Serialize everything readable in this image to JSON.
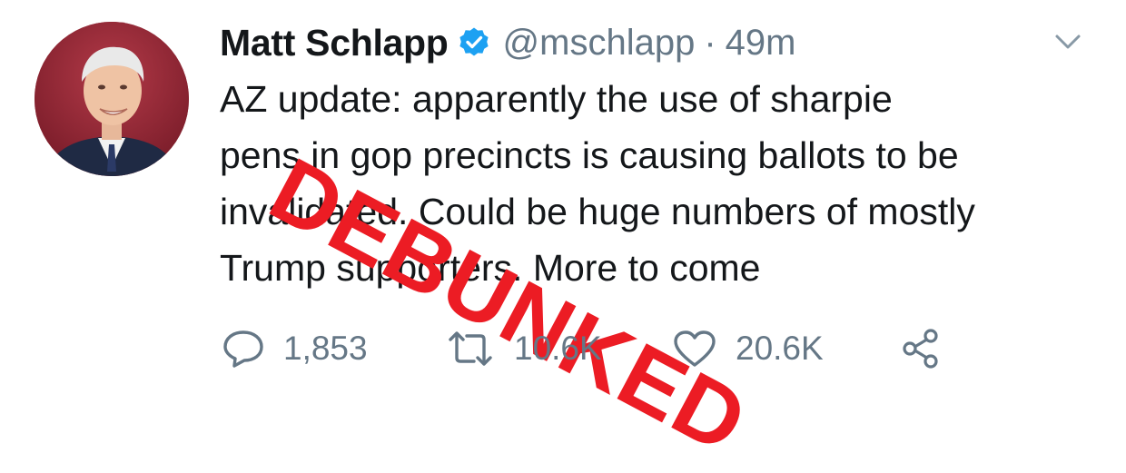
{
  "tweet": {
    "author_name": "Matt Schlapp",
    "handle": "@mschlapp",
    "separator": "·",
    "time": "49m",
    "text_lines": [
      "AZ update: apparently the use of sharpie",
      "pens in gop precincts is causing ballots to be",
      "invalidated. Could be huge numbers of mostly",
      "Trump supporters. More to come"
    ],
    "overlay_stamp": "DEBUNKED",
    "overlay_color": "#ec1c24",
    "verified_color": "#1da1f2",
    "icons": {
      "verified": "verified-badge-icon",
      "menu": "chevron-down-icon",
      "reply": "reply-icon",
      "retweet": "retweet-icon",
      "like": "heart-icon",
      "share": "share-icon"
    },
    "stats": {
      "replies": "1,853",
      "retweets": "10.6K",
      "likes": "20.6K"
    }
  }
}
